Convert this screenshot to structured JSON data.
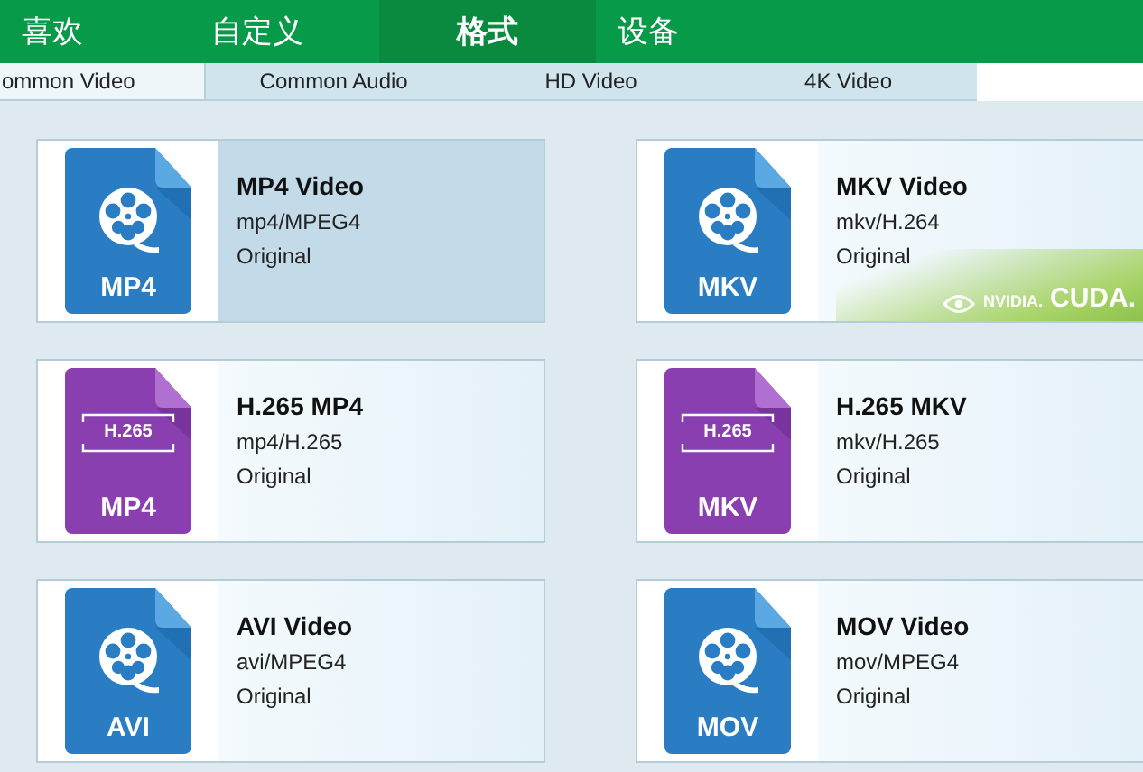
{
  "nav": [
    {
      "label": "喜欢",
      "selected": false
    },
    {
      "label": "自定义",
      "selected": false
    },
    {
      "label": "格式",
      "selected": true
    },
    {
      "label": "设备",
      "selected": false
    }
  ],
  "subtabs": [
    {
      "label": "ommon Video",
      "selected": true
    },
    {
      "label": "Common Audio",
      "selected": false
    },
    {
      "label": "HD Video",
      "selected": false
    },
    {
      "label": "4K Video",
      "selected": false
    }
  ],
  "formats": [
    {
      "kind": "reel",
      "badge_text": "MP4",
      "title": "MP4 Video",
      "codec": "mp4/MPEG4",
      "quality": "Original",
      "selected": true
    },
    {
      "kind": "reel",
      "badge_text": "MKV",
      "title": "MKV Video",
      "codec": "mkv/H.264",
      "quality": "Original",
      "selected": false,
      "accel": [
        "NVIDIA.",
        "CUDA."
      ]
    },
    {
      "kind": "hevc",
      "badge_text": "MP4",
      "codec_label": "H.265",
      "title": "H.265 MP4",
      "codec": "mp4/H.265",
      "quality": "Original",
      "selected": false
    },
    {
      "kind": "hevc",
      "badge_text": "MKV",
      "codec_label": "H.265",
      "title": "H.265 MKV",
      "codec": "mkv/H.265",
      "quality": "Original",
      "selected": false
    },
    {
      "kind": "reel",
      "badge_text": "AVI",
      "title": "AVI Video",
      "codec": "avi/MPEG4",
      "quality": "Original",
      "selected": false
    },
    {
      "kind": "reel",
      "badge_text": "MOV",
      "title": "MOV Video",
      "codec": "mov/MPEG4",
      "quality": "Original",
      "selected": false
    }
  ]
}
